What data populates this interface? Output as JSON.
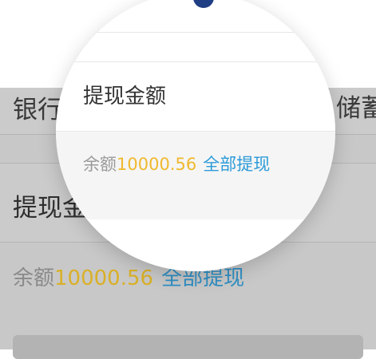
{
  "background": {
    "bank_label": "银行",
    "bank_suffix": "储蓄",
    "amount_label": "提现金",
    "balance_label": "余额",
    "balance_value": "10000.56",
    "withdraw_all": "全部提现"
  },
  "lens": {
    "amount_label": "提现金额",
    "balance_label": "余额",
    "balance_value": "10000.56",
    "withdraw_all": "全部提现"
  },
  "colors": {
    "balance_value": "#f0b92e",
    "link": "#2d9bd8",
    "accent_dot": "#1f3e84"
  }
}
